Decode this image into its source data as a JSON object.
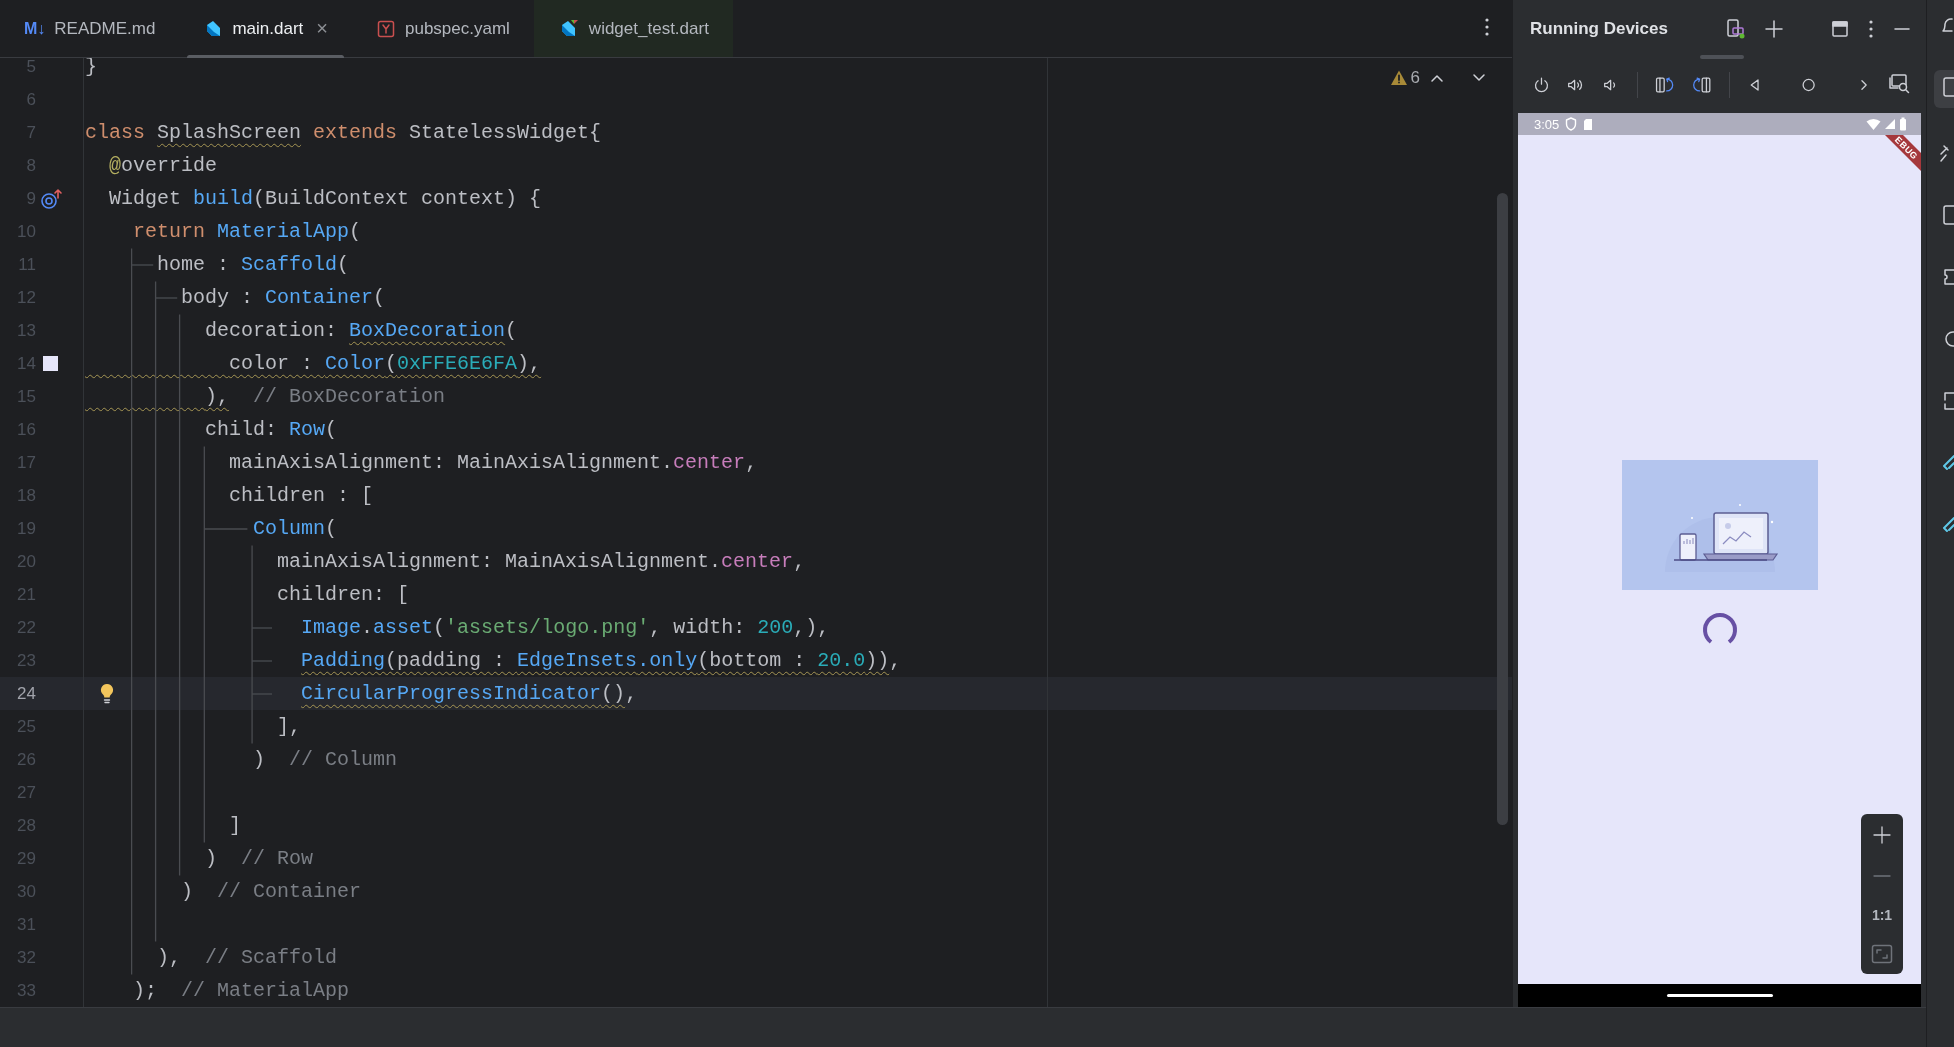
{
  "editor_tabs": [
    {
      "kind": "markdown",
      "icon": "M↓",
      "label": "README.md",
      "selected": false
    },
    {
      "kind": "dart",
      "label": "main.dart",
      "selected": true,
      "close": "×"
    },
    {
      "kind": "yaml",
      "label": "pubspec.yaml",
      "selected": false
    },
    {
      "kind": "dart_test",
      "label": "widget_test.dart",
      "selected": false
    }
  ],
  "inspection": {
    "warnings": "6"
  },
  "code_lines": [
    {
      "number": "5",
      "current": false,
      "tokens": [
        {
          "kind": "plain",
          "text": "}"
        }
      ]
    },
    {
      "number": "6",
      "current": false
    },
    {
      "number": "7",
      "current": false,
      "tokens": [
        {
          "kind": "keyword",
          "text": "class "
        },
        {
          "kind": "plain",
          "text": "SplashScreen",
          "squiggle": true
        },
        {
          "kind": "keyword",
          "text": " extends "
        },
        {
          "kind": "plain",
          "text": "StatelessWidget{"
        }
      ]
    },
    {
      "number": "8",
      "current": false,
      "tokens": [
        {
          "kind": "annotation",
          "text": "  @"
        },
        {
          "kind": "plain",
          "text": "override"
        }
      ]
    },
    {
      "number": "9",
      "current": false,
      "marker": {
        "kind": "override"
      },
      "tokens": [
        {
          "kind": "plain",
          "text": "  Widget "
        },
        {
          "kind": "call",
          "text": "build"
        },
        {
          "kind": "plain",
          "text": "(BuildContext context) {"
        }
      ]
    },
    {
      "number": "10",
      "current": false,
      "tokens": [
        {
          "kind": "keyword",
          "text": "    return "
        },
        {
          "kind": "call",
          "text": "MaterialApp"
        },
        {
          "kind": "plain",
          "text": "("
        }
      ]
    },
    {
      "number": "11",
      "current": false,
      "tokens": [
        {
          "kind": "plain",
          "text": "      home : "
        },
        {
          "kind": "call",
          "text": "Scaffold"
        },
        {
          "kind": "plain",
          "text": "("
        }
      ]
    },
    {
      "number": "12",
      "current": false,
      "tokens": [
        {
          "kind": "plain",
          "text": "        body : "
        },
        {
          "kind": "call",
          "text": "Container"
        },
        {
          "kind": "plain",
          "text": "("
        }
      ]
    },
    {
      "number": "13",
      "current": false,
      "tokens": [
        {
          "kind": "plain",
          "text": "          decoration: "
        },
        {
          "kind": "call",
          "text": "BoxDecoration",
          "squiggle": true
        },
        {
          "kind": "plain",
          "text": "("
        }
      ]
    },
    {
      "number": "14",
      "current": false,
      "marker": {
        "kind": "color_swatch",
        "color": "#e6e6fa"
      },
      "tokens": [
        {
          "kind": "plain",
          "text": "            color : ",
          "squiggle": true
        },
        {
          "kind": "call",
          "text": "Color",
          "squiggle": true
        },
        {
          "kind": "plain",
          "text": "(",
          "squiggle": true
        },
        {
          "kind": "number",
          "text": "0xFFE6E6FA",
          "squiggle": true
        },
        {
          "kind": "plain",
          "text": "),",
          "squiggle": true
        }
      ]
    },
    {
      "number": "15",
      "current": false,
      "tokens": [
        {
          "kind": "plain",
          "text": "          ),",
          "squiggle": true
        },
        {
          "kind": "comment",
          "text": "  // BoxDecoration"
        }
      ]
    },
    {
      "number": "16",
      "current": false,
      "tokens": [
        {
          "kind": "plain",
          "text": "          child: "
        },
        {
          "kind": "call",
          "text": "Row"
        },
        {
          "kind": "plain",
          "text": "("
        }
      ]
    },
    {
      "number": "17",
      "current": false,
      "tokens": [
        {
          "kind": "plain",
          "text": "            mainAxisAlignment: MainAxisAlignment."
        },
        {
          "kind": "member",
          "text": "center"
        },
        {
          "kind": "plain",
          "text": ","
        }
      ]
    },
    {
      "number": "18",
      "current": false,
      "tokens": [
        {
          "kind": "plain",
          "text": "            children : ["
        }
      ]
    },
    {
      "number": "19",
      "current": false,
      "tokens": [
        {
          "kind": "call",
          "text": "              Column"
        },
        {
          "kind": "plain",
          "text": "("
        }
      ]
    },
    {
      "number": "20",
      "current": false,
      "tokens": [
        {
          "kind": "plain",
          "text": "                mainAxisAlignment: MainAxisAlignment."
        },
        {
          "kind": "member",
          "text": "center"
        },
        {
          "kind": "plain",
          "text": ","
        }
      ]
    },
    {
      "number": "21",
      "current": false,
      "tokens": [
        {
          "kind": "plain",
          "text": "                children: ["
        }
      ]
    },
    {
      "number": "22",
      "current": false,
      "tokens": [
        {
          "kind": "call",
          "text": "                  Image"
        },
        {
          "kind": "plain",
          "text": "."
        },
        {
          "kind": "call",
          "text": "asset"
        },
        {
          "kind": "plain",
          "text": "("
        },
        {
          "kind": "string",
          "text": "'assets/logo.png'"
        },
        {
          "kind": "plain",
          "text": ", width: "
        },
        {
          "kind": "number",
          "text": "200"
        },
        {
          "kind": "plain",
          "text": ",),"
        }
      ]
    },
    {
      "number": "23",
      "current": false,
      "tokens": [
        {
          "kind": "call",
          "text": "                  Padding",
          "squiggle": true
        },
        {
          "kind": "plain",
          "text": "(padding : ",
          "squiggle": true
        },
        {
          "kind": "call",
          "text": "EdgeInsets",
          "squiggle": true
        },
        {
          "kind": "call",
          "text": ".only",
          "squiggle": true
        },
        {
          "kind": "plain",
          "text": "(bottom : ",
          "squiggle": true
        },
        {
          "kind": "number",
          "text": "20.0",
          "squiggle": true
        },
        {
          "kind": "plain",
          "text": "))",
          "squiggle": true
        },
        {
          "kind": "plain",
          "text": ","
        }
      ]
    },
    {
      "number": "24",
      "current": true,
      "marker": {
        "kind": "bulb"
      },
      "tokens": [
        {
          "kind": "call",
          "text": "                  CircularProgressIndicator",
          "squiggle": true
        },
        {
          "kind": "plain",
          "text": "()",
          "squiggle": true
        },
        {
          "kind": "plain",
          "text": ","
        }
      ]
    },
    {
      "number": "25",
      "current": false,
      "tokens": [
        {
          "kind": "plain",
          "text": "                ],"
        }
      ]
    },
    {
      "number": "26",
      "current": false,
      "tokens": [
        {
          "kind": "plain",
          "text": "              )"
        },
        {
          "kind": "comment",
          "text": "  // Column"
        }
      ]
    },
    {
      "number": "27",
      "current": false
    },
    {
      "number": "28",
      "current": false,
      "tokens": [
        {
          "kind": "plain",
          "text": "            ]"
        }
      ]
    },
    {
      "number": "29",
      "current": false,
      "tokens": [
        {
          "kind": "plain",
          "text": "          )"
        },
        {
          "kind": "comment",
          "text": "  // Row"
        }
      ]
    },
    {
      "number": "30",
      "current": false,
      "tokens": [
        {
          "kind": "plain",
          "text": "        )"
        },
        {
          "kind": "comment",
          "text": "  // Container"
        }
      ]
    },
    {
      "number": "31",
      "current": false
    },
    {
      "number": "32",
      "current": false,
      "tokens": [
        {
          "kind": "plain",
          "text": "      ),"
        },
        {
          "kind": "comment",
          "text": "  // Scaffold"
        }
      ]
    },
    {
      "number": "33",
      "current": false,
      "tokens": [
        {
          "kind": "plain",
          "text": "    );"
        },
        {
          "kind": "comment",
          "text": "  // MaterialApp"
        }
      ]
    }
  ],
  "running_devices": {
    "title": "Running Devices",
    "phone": {
      "status_time": "3:05",
      "debug_banner": "EBUG",
      "zoom_reset": "1:1"
    }
  }
}
